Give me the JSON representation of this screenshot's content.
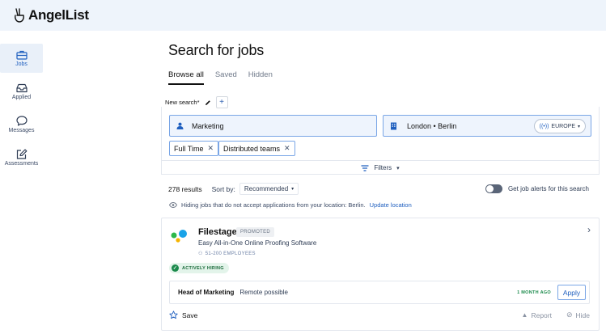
{
  "brand": {
    "name": "AngelList"
  },
  "sidebar": {
    "items": [
      {
        "label": "Jobs",
        "icon": "briefcase-icon",
        "active": true
      },
      {
        "label": "Applied",
        "icon": "inbox-icon",
        "active": false
      },
      {
        "label": "Messages",
        "icon": "chat-bubble-icon",
        "active": false
      },
      {
        "label": "Assessments",
        "icon": "edit-square-icon",
        "active": false
      }
    ]
  },
  "page": {
    "title": "Search for jobs",
    "tabs": [
      {
        "label": "Browse all",
        "active": true
      },
      {
        "label": "Saved",
        "active": false
      },
      {
        "label": "Hidden",
        "active": false
      }
    ]
  },
  "search": {
    "saved_search_label": "New search*",
    "role_value": "Marketing",
    "location_value": "London • Berlin",
    "region_label": "EUROPE",
    "chips": [
      "Full Time",
      "Distributed teams"
    ],
    "filters_label": "Filters"
  },
  "results": {
    "count_label": "278 results",
    "sort_label": "Sort by:",
    "sort_value": "Recommended",
    "alert_label": "Get job alerts for this search",
    "alert_enabled": false,
    "hiding_text": "Hiding jobs that do not accept applications from your location: Berlin.",
    "update_link": "Update location"
  },
  "listing": {
    "company": "Filestage",
    "promoted_label": "PROMOTED",
    "tagline": "Easy All-in-One Online Proofing Software",
    "employees": "51-200 EMPLOYEES",
    "hiring_label": "ACTIVELY HIRING",
    "job": {
      "title": "Head of Marketing",
      "remote": "Remote possible",
      "posted": "1 MONTH AGO",
      "apply_label": "Apply"
    },
    "save_label": "Save",
    "report_label": "Report",
    "hide_label": "Hide"
  },
  "colors": {
    "accent": "#1f5fbf",
    "topbar": "#eef4fb",
    "field_bg": "#eef4fd",
    "hiring_green": "#1b8a4b"
  }
}
